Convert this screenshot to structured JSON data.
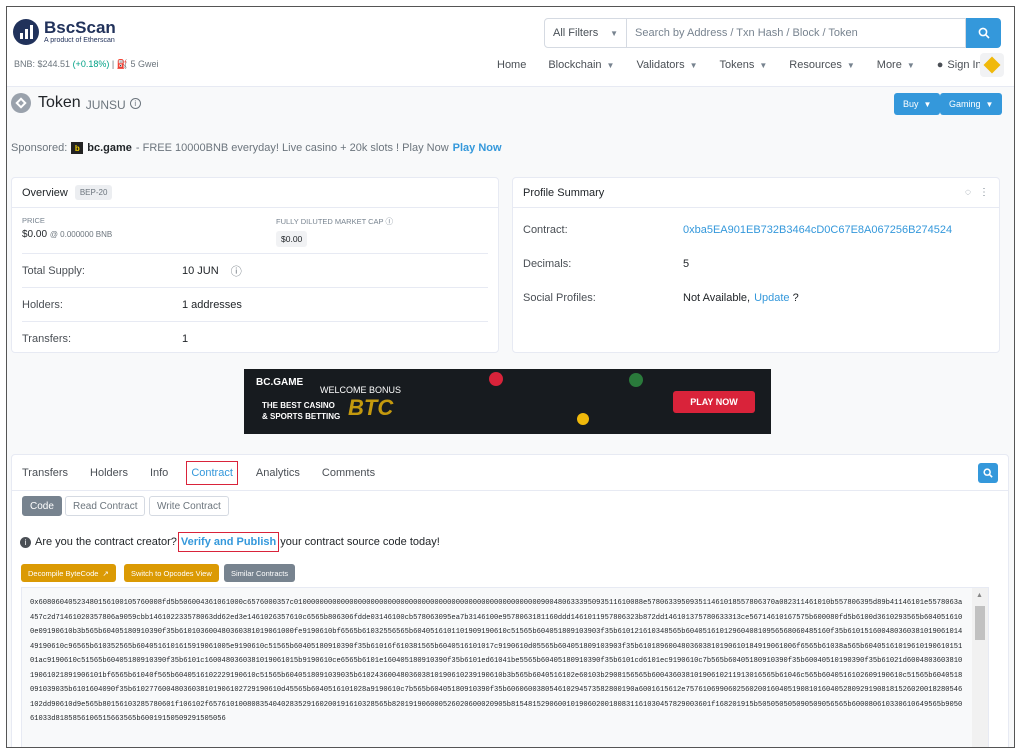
{
  "logo": {
    "title": "BscScan",
    "subtitle": "A product of Etherscan"
  },
  "price": {
    "bnb": "BNB: $244.51",
    "change": "(+0.18%)",
    "sep": "|",
    "gas": "5 Gwei"
  },
  "search": {
    "filter": "All Filters",
    "placeholder": "Search by Address / Txn Hash / Block / Token"
  },
  "nav": {
    "home": "Home",
    "blockchain": "Blockchain",
    "validators": "Validators",
    "tokens": "Tokens",
    "resources": "Resources",
    "more": "More",
    "signin": "Sign In"
  },
  "token": {
    "title": "Token",
    "name": "JUNSU",
    "buy": "Buy",
    "gaming": "Gaming"
  },
  "sponsored": {
    "label": "Sponsored:",
    "brand": "bc.game",
    "text": "- FREE 10000BNB everyday! Live casino + 20k slots ! Play Now",
    "cta": "Play Now"
  },
  "overview": {
    "title": "Overview",
    "badge": "BEP-20",
    "price_label": "PRICE",
    "price_value": "$0.00",
    "price_bnb": "@ 0.000000 BNB",
    "fdmc_label": "FULLY DILUTED MARKET CAP",
    "fdmc_value": "$0.00",
    "supply_label": "Total Supply:",
    "supply_value": "10 JUN",
    "holders_label": "Holders:",
    "holders_value": "1 addresses",
    "transfers_label": "Transfers:",
    "transfers_value": "1"
  },
  "profile": {
    "title": "Profile Summary",
    "contract_label": "Contract:",
    "contract_value": "0xba5EA901EB732B3464cD0C67E8A067256B274524",
    "decimals_label": "Decimals:",
    "decimals_value": "5",
    "social_label": "Social Profiles:",
    "social_value": "Not Available,",
    "social_update": "Update",
    "social_q": "?"
  },
  "banner": {
    "brand": "BC.GAME",
    "welcome": "WELCOME BONUS",
    "line1": "THE BEST CASINO",
    "line2": "& SPORTS BETTING",
    "coin": "BTC",
    "play": "PLAY NOW"
  },
  "tabs": {
    "transfers": "Transfers",
    "holders": "Holders",
    "info": "Info",
    "contract": "Contract",
    "analytics": "Analytics",
    "comments": "Comments"
  },
  "subtabs": {
    "code": "Code",
    "read": "Read Contract",
    "write": "Write Contract"
  },
  "creator": {
    "pre": "Are you the contract creator?",
    "verify": "Verify and Publish",
    "post": "your contract source code today!"
  },
  "actions": {
    "decompile": "Decompile ByteCode",
    "opcodes": "Switch to Opcodes View",
    "similar": "Similar Contracts"
  },
  "bytecode": "0x60806040523480156100105760008fd5b506004361061000c6576000357c0100000000000000000000000000000000000000000000000000000000900480633395093511610088e578063395093511461018557806370a082311461010b557806395d89b41146101e5578063a457c2d71461020357806a9059cbb146102233578063dd62ed3e1461026357610c6565b806306fdde03146100cb578063095ea7b3146100e9578063181160ddd1461011957806323b872dd146101375780633313ce56714610167575b600080fd5b6100d3610293565b6040516100e09190610b3b565b60405180910390f35b610103600480360381019061000fe9190610bf6565b61032556565b6040516101101909190610c51565b604051809103903f35b610121610348565b6040516101296040810956568060485160f35b61015160048036038101906101449190610c96565b610352565b6040516101615919061005e9190610c51565b60405180910390f35b61016f610381565b6040516101017c9190610d05565b604051809103903f35b6101896004803603810190610184919061006f6565b61038a565b6040516101961019061015101ac9190610c51565b60405180910390f35b6101c1600480360381019061015b9190610ce6565b6101e160405180910390f35b6101ed61041be5565b60405180910390f35b6101cd6101ec9190610c7b565b60405180910390f35b60040510190390f35b61021d600480360381019061021891906101bf6565b61040f565b6040516102229190610c51565b6040518091039035b6102436004803603810190610239190610b3b565b6040516102e60103b2908156565b60043603810190610211913016565b61046c565b6040516102609190610c51565b6040518091039035b6101604090f35b61027760048036038101906102729190610d45565b6040516101028a9190610c7b565b60405180910390f35b606060038054610294573582800190a6001615612e75761069906025602001604051908101604052809291908181526020018280546102dd90610d9e565b80156103285780601f106102f657610100808354040283529160200191610328565b820191906000526020600020905b81548152906001019060200180831161030457829003601f168201915b505050505090509056565b600080610330610649565b905061033d8185856106515663565b60019150509291505056"
}
